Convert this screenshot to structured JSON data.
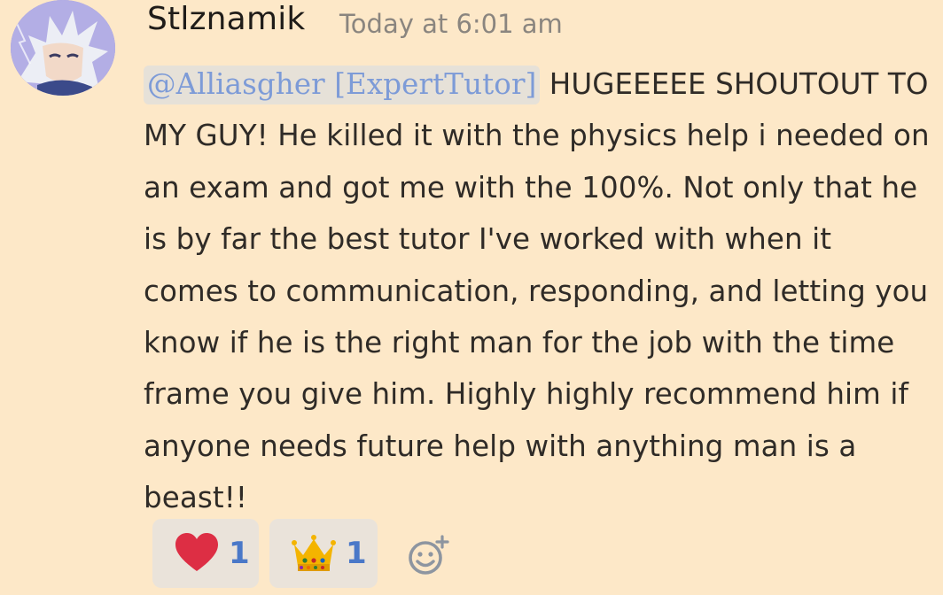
{
  "message": {
    "author": "Stlznamik",
    "timestamp": "Today at 6:01 am",
    "mention": "@Alliasgher [ExpertTutor]",
    "text_after_mention": " HUGEEEEE SHOUTOUT TO MY GUY! He killed it with the physics help i needed on an exam and got me with the 100%. Not only that he is by far the best tutor I've worked with when it comes to communication, responding, and letting you know if he is the right man for the job with the time frame you give him. Highly highly recommend him if anyone needs future help with anything man is a beast!!"
  },
  "reactions": [
    {
      "icon": "heart-emoji",
      "count": "1"
    },
    {
      "icon": "crown-emoji",
      "count": "1"
    }
  ],
  "add_reaction": {
    "icon": "add-reaction-icon"
  },
  "colors": {
    "background": "#fde8c8",
    "mention_text": "#7d9bd7",
    "reaction_count": "#4a78c8",
    "timestamp": "#8a857f"
  }
}
